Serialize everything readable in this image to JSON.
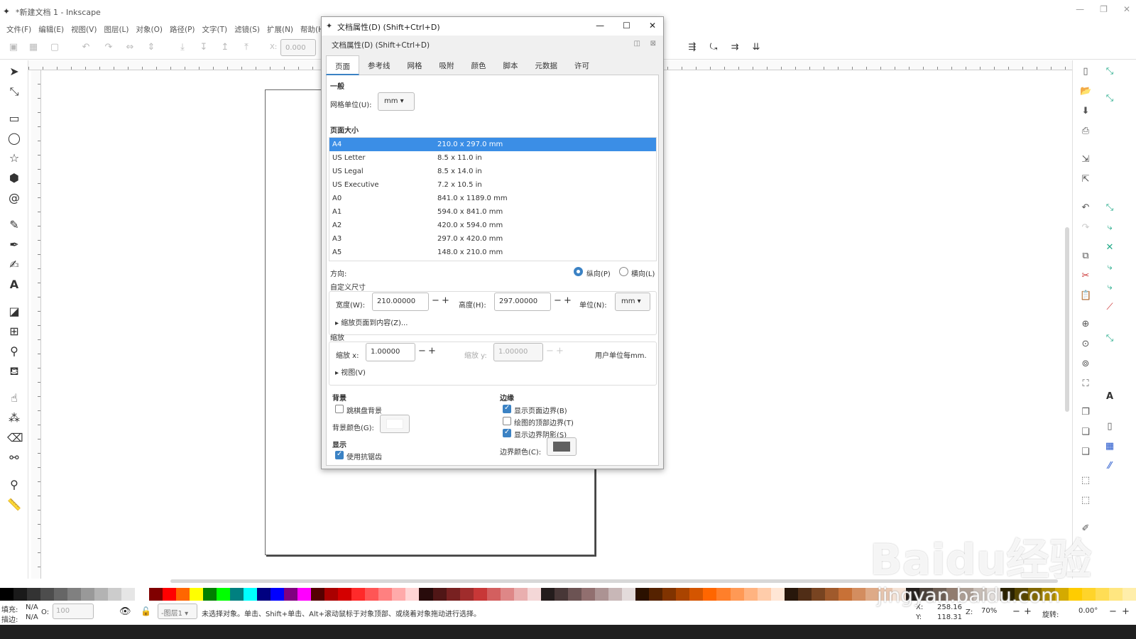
{
  "window": {
    "title": "*新建文档 1 - Inkscape"
  },
  "menu": [
    "文件(F)",
    "编辑(E)",
    "视图(V)",
    "图层(L)",
    "对象(O)",
    "路径(P)",
    "文字(T)",
    "滤镜(S)",
    "扩展(N)",
    "帮助(H)"
  ],
  "toolbar": {
    "x_label": "X:",
    "x_value": "0.000"
  },
  "dialog": {
    "title": "文档属性(D) (Shift+Ctrl+D)",
    "subtitle": "文档属性(D) (Shift+Ctrl+D)",
    "tabs": [
      "页面",
      "参考线",
      "网格",
      "吸附",
      "颜色",
      "脚本",
      "元数据",
      "许可"
    ],
    "general_header": "一般",
    "display_units_label": "网格单位(U):",
    "display_units_value": "mm",
    "page_size_header": "页面大小",
    "page_sizes": [
      {
        "name": "A4",
        "size": "210.0 x 297.0 mm"
      },
      {
        "name": "US Letter",
        "size": "8.5 x 11.0 in"
      },
      {
        "name": "US Legal",
        "size": "8.5 x 14.0 in"
      },
      {
        "name": "US Executive",
        "size": "7.2 x 10.5 in"
      },
      {
        "name": "A0",
        "size": "841.0 x 1189.0 mm"
      },
      {
        "name": "A1",
        "size": "594.0 x 841.0 mm"
      },
      {
        "name": "A2",
        "size": "420.0 x 594.0 mm"
      },
      {
        "name": "A3",
        "size": "297.0 x 420.0 mm"
      },
      {
        "name": "A5",
        "size": "148.0 x 210.0 mm"
      }
    ],
    "orientation_label": "方向:",
    "portrait_label": "纵向(P)",
    "landscape_label": "横向(L)",
    "custom_size_header": "自定义尺寸",
    "width_label": "宽度(W):",
    "width_value": "210.00000",
    "height_label": "高度(H):",
    "height_value": "297.00000",
    "units_label": "单位(N):",
    "units_value": "mm",
    "resize_expander": "缩放页面到内容(Z)...",
    "scale_header": "缩放",
    "scale_x_label": "缩放 x:",
    "scale_x_value": "1.00000",
    "scale_y_label": "缩放 y:",
    "scale_y_value": "1.00000",
    "user_units_text": "用户单位每mm.",
    "viewbox_expander": "视图(V)",
    "background_header": "背景",
    "checkerboard_label": "跳棋盘背景",
    "bg_color_label": "背景颜色(G):",
    "display_header": "显示",
    "antialias_label": "使用抗锯齿",
    "border_header": "边缘",
    "show_border_label": "显示页面边界(B)",
    "border_on_top_label": "绘图的顶部边界(T)",
    "border_shadow_label": "显示边界阴影(S)",
    "border_color_label": "边界颜色(C):"
  },
  "status": {
    "fill_label": "填充:",
    "fill_value": "N/A",
    "stroke_label": "描边:",
    "stroke_value": "N/A",
    "opacity_label": "O:",
    "opacity_value": "100",
    "layer": "-图层1",
    "message": "未选择对象。单击、Shift+单击、Alt+滚动鼠标于对象顶部、或绕着对象拖动进行选择。",
    "x_label": "X:",
    "x_value": "258.16",
    "y_label": "Y:",
    "y_value": "118.31",
    "zoom_label": "Z:",
    "zoom_value": "70%",
    "rotate_label": "旋转:",
    "rotate_value": "0.00°"
  },
  "watermark": {
    "line1": "Baidu经验",
    "line2": "jingyan.baidu.com"
  },
  "colors": {
    "accent": "#3b82c4",
    "arrow": "#e0242a",
    "border_color": "#606060"
  }
}
